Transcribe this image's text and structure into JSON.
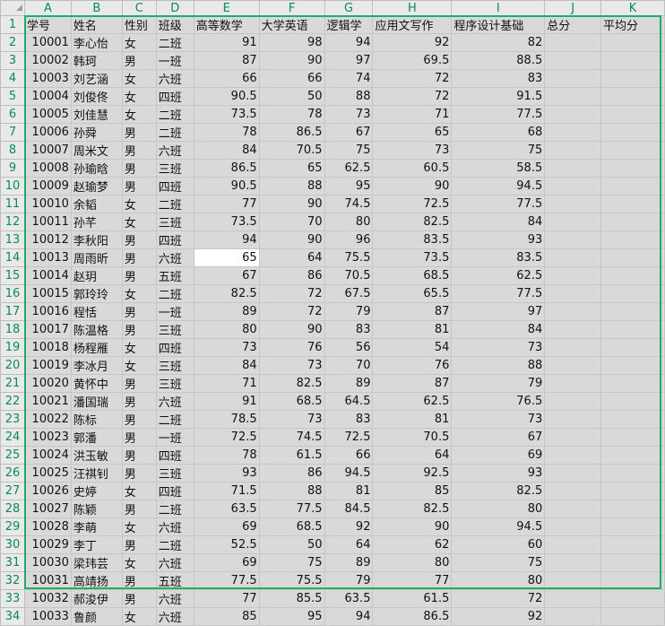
{
  "corner": "◢",
  "col_letters": [
    "A",
    "B",
    "C",
    "D",
    "E",
    "F",
    "G",
    "H",
    "I",
    "J",
    "K"
  ],
  "header_row": [
    "学号",
    "姓名",
    "性别",
    "班级",
    "高等数学",
    "大学英语",
    "逻辑学",
    "应用文写作",
    "程序设计基础",
    "总分",
    "平均分"
  ],
  "rows": [
    [
      "10001",
      "李心怡",
      "女",
      "二班",
      "91",
      "98",
      "94",
      "92",
      "82",
      "",
      ""
    ],
    [
      "10002",
      "韩珂",
      "男",
      "一班",
      "87",
      "90",
      "97",
      "69.5",
      "88.5",
      "",
      ""
    ],
    [
      "10003",
      "刘艺涵",
      "女",
      "六班",
      "66",
      "66",
      "74",
      "72",
      "83",
      "",
      ""
    ],
    [
      "10004",
      "刘俊佟",
      "女",
      "四班",
      "90.5",
      "50",
      "88",
      "72",
      "91.5",
      "",
      ""
    ],
    [
      "10005",
      "刘佳慧",
      "女",
      "二班",
      "73.5",
      "78",
      "73",
      "71",
      "77.5",
      "",
      ""
    ],
    [
      "10006",
      "孙舜",
      "男",
      "二班",
      "78",
      "86.5",
      "67",
      "65",
      "68",
      "",
      ""
    ],
    [
      "10007",
      "周米文",
      "男",
      "六班",
      "84",
      "70.5",
      "75",
      "73",
      "75",
      "",
      ""
    ],
    [
      "10008",
      "孙瑜晗",
      "男",
      "三班",
      "86.5",
      "65",
      "62.5",
      "60.5",
      "58.5",
      "",
      ""
    ],
    [
      "10009",
      "赵瑜梦",
      "男",
      "四班",
      "90.5",
      "88",
      "95",
      "90",
      "94.5",
      "",
      ""
    ],
    [
      "10010",
      "余韬",
      "女",
      "二班",
      "77",
      "90",
      "74.5",
      "72.5",
      "77.5",
      "",
      ""
    ],
    [
      "10011",
      "孙芊",
      "女",
      "三班",
      "73.5",
      "70",
      "80",
      "82.5",
      "84",
      "",
      ""
    ],
    [
      "10012",
      "李秋阳",
      "男",
      "四班",
      "94",
      "90",
      "96",
      "83.5",
      "93",
      "",
      ""
    ],
    [
      "10013",
      "周雨昕",
      "男",
      "六班",
      "65",
      "64",
      "75.5",
      "73.5",
      "83.5",
      "",
      ""
    ],
    [
      "10014",
      "赵玥",
      "男",
      "五班",
      "67",
      "86",
      "70.5",
      "68.5",
      "62.5",
      "",
      ""
    ],
    [
      "10015",
      "郭玲玲",
      "女",
      "二班",
      "82.5",
      "72",
      "67.5",
      "65.5",
      "77.5",
      "",
      ""
    ],
    [
      "10016",
      "程恬",
      "男",
      "一班",
      "89",
      "72",
      "79",
      "87",
      "97",
      "",
      ""
    ],
    [
      "10017",
      "陈温格",
      "男",
      "三班",
      "80",
      "90",
      "83",
      "81",
      "84",
      "",
      ""
    ],
    [
      "10018",
      "杨程雁",
      "女",
      "四班",
      "73",
      "76",
      "56",
      "54",
      "73",
      "",
      ""
    ],
    [
      "10019",
      "李冰月",
      "女",
      "三班",
      "84",
      "73",
      "70",
      "76",
      "88",
      "",
      ""
    ],
    [
      "10020",
      "黄怀中",
      "男",
      "三班",
      "71",
      "82.5",
      "89",
      "87",
      "79",
      "",
      ""
    ],
    [
      "10021",
      "潘国瑞",
      "男",
      "六班",
      "91",
      "68.5",
      "64.5",
      "62.5",
      "76.5",
      "",
      ""
    ],
    [
      "10022",
      "陈标",
      "男",
      "二班",
      "78.5",
      "73",
      "83",
      "81",
      "73",
      "",
      ""
    ],
    [
      "10023",
      "郭潘",
      "男",
      "一班",
      "72.5",
      "74.5",
      "72.5",
      "70.5",
      "67",
      "",
      ""
    ],
    [
      "10024",
      "洪玉敏",
      "男",
      "四班",
      "78",
      "61.5",
      "66",
      "64",
      "69",
      "",
      ""
    ],
    [
      "10025",
      "汪祺钊",
      "男",
      "三班",
      "93",
      "86",
      "94.5",
      "92.5",
      "93",
      "",
      ""
    ],
    [
      "10026",
      "史婷",
      "女",
      "四班",
      "71.5",
      "88",
      "81",
      "85",
      "82.5",
      "",
      ""
    ],
    [
      "10027",
      "陈颖",
      "男",
      "二班",
      "63.5",
      "77.5",
      "84.5",
      "82.5",
      "80",
      "",
      ""
    ],
    [
      "10028",
      "李萌",
      "女",
      "六班",
      "69",
      "68.5",
      "92",
      "90",
      "94.5",
      "",
      ""
    ],
    [
      "10029",
      "李丁",
      "男",
      "二班",
      "52.5",
      "50",
      "64",
      "62",
      "60",
      "",
      ""
    ],
    [
      "10030",
      "梁玮芸",
      "女",
      "六班",
      "69",
      "75",
      "89",
      "80",
      "75",
      "",
      ""
    ],
    [
      "10031",
      "高靖扬",
      "男",
      "五班",
      "77.5",
      "75.5",
      "79",
      "77",
      "80",
      "",
      ""
    ],
    [
      "10032",
      "郝浚伊",
      "男",
      "六班",
      "77",
      "85.5",
      "63.5",
      "61.5",
      "72",
      "",
      ""
    ],
    [
      "10033",
      "鲁颜",
      "女",
      "六班",
      "85",
      "95",
      "94",
      "86.5",
      "92",
      "",
      ""
    ]
  ],
  "selected_cell": "E14"
}
